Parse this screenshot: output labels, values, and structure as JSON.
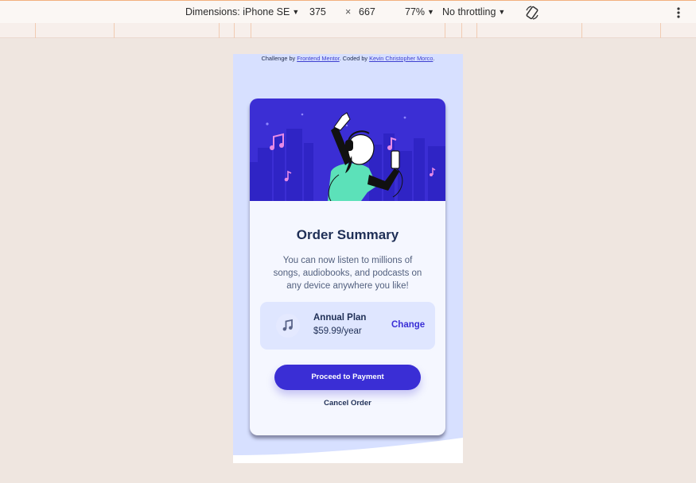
{
  "devtools": {
    "dimensions_label": "Dimensions: iPhone SE",
    "width": "375",
    "times": "×",
    "height": "667",
    "zoom": "77%",
    "throttling": "No throttling",
    "rotate_icon": "rotate-icon",
    "more_icon": "more-vertical-icon"
  },
  "page": {
    "credit": {
      "prefix": "Challenge by ",
      "link1": "Frontend Mentor",
      "middle": ". Coded by ",
      "link2": "Kevin Christopher Morco",
      "suffix": "."
    },
    "card": {
      "hero_image": "music-illustration",
      "title": "Order Summary",
      "description": "You can now listen to millions of songs, audiobooks, and podcasts on any device anywhere you like!",
      "plan": {
        "icon": "music-note-icon",
        "name": "Annual Plan",
        "price": "$59.99/year",
        "change_label": "Change"
      },
      "proceed_label": "Proceed to Payment",
      "cancel_label": "Cancel Order"
    }
  },
  "colors": {
    "primary": "#3a2ed5",
    "dark_blue": "#1f2f56",
    "pale_blue": "#d7e0ff",
    "card_bg": "#f5f7ff"
  }
}
